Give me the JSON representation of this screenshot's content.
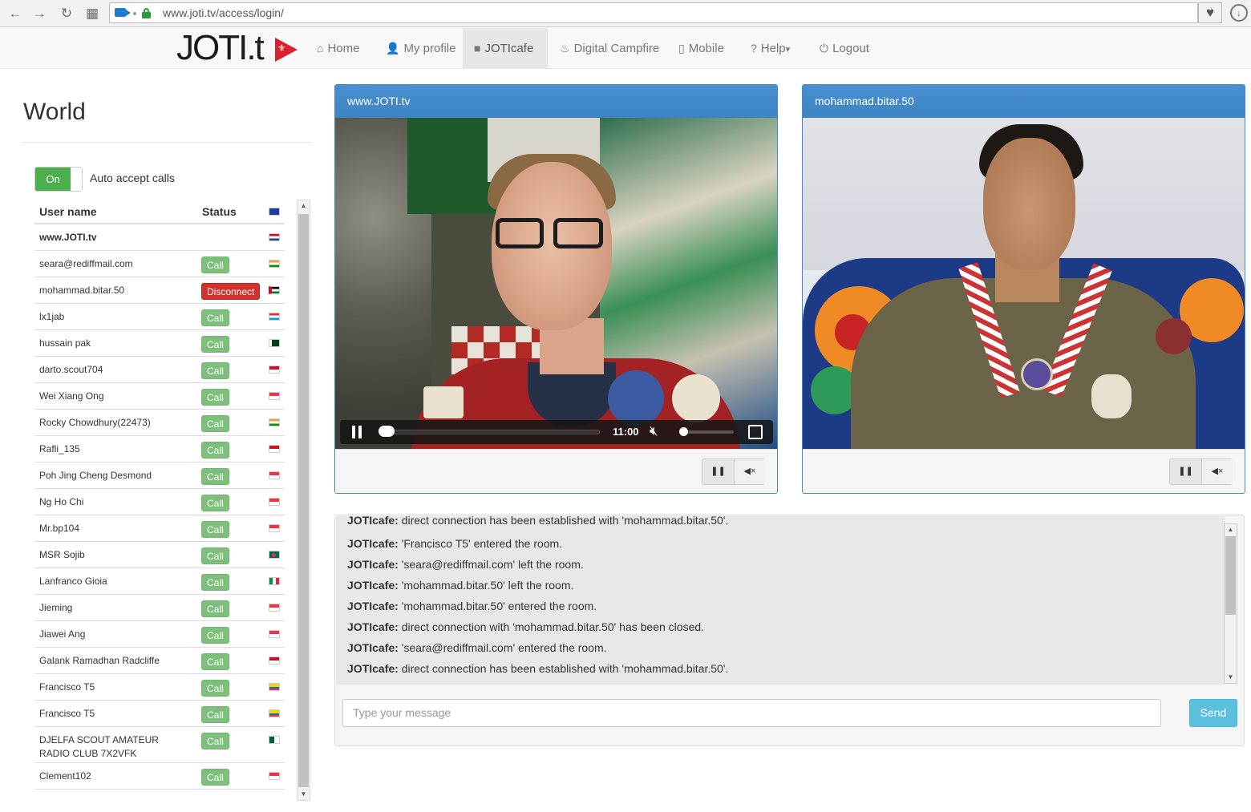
{
  "browser": {
    "url": "www.joti.tv/access/login/",
    "back_icon": "←",
    "forward_icon": "→",
    "reload_icon": "↻",
    "apps_icon": "▦",
    "heart_icon": "♥",
    "download_icon": "↓"
  },
  "navbar": {
    "logo": "JOTI.t",
    "items": [
      {
        "label": "Home",
        "icon": "home-icon",
        "glyph": "⌂"
      },
      {
        "label": "My profile",
        "icon": "user-icon",
        "glyph": "👤"
      },
      {
        "label": "JOTIcafe",
        "icon": "video-camera-icon",
        "glyph": "■"
      },
      {
        "label": "Digital Campfire",
        "icon": "fire-icon",
        "glyph": "♨"
      },
      {
        "label": "Mobile",
        "icon": "mobile-icon",
        "glyph": "▯"
      },
      {
        "label": "Help",
        "icon": "question-icon",
        "glyph": "?",
        "caret": "▾"
      },
      {
        "label": "Logout",
        "icon": "power-icon",
        "glyph": "⏻"
      }
    ],
    "active": "JOTIcafe"
  },
  "sidebar": {
    "title": "World",
    "toggle_label": "On",
    "auto_accept_label": "Auto accept calls",
    "columns": [
      "User name",
      "Status"
    ],
    "header_flag": "eu",
    "users": [
      {
        "name": "www.JOTI.tv",
        "action": "",
        "flag": "nl"
      },
      {
        "name": "seara@rediffmail.com",
        "action": "Call",
        "flag": "in"
      },
      {
        "name": "mohammad.bitar.50",
        "action": "Disconnect",
        "flag": "jo"
      },
      {
        "name": "lx1jab",
        "action": "Call",
        "flag": "lu"
      },
      {
        "name": "hussain pak",
        "action": "Call",
        "flag": "pk"
      },
      {
        "name": "darto.scout704",
        "action": "Call",
        "flag": "id"
      },
      {
        "name": "Wei Xiang Ong",
        "action": "Call",
        "flag": "sg"
      },
      {
        "name": "Rocky Chowdhury(22473)",
        "action": "Call",
        "flag": "in"
      },
      {
        "name": "Rafli_135",
        "action": "Call",
        "flag": "id"
      },
      {
        "name": "Poh Jing Cheng Desmond",
        "action": "Call",
        "flag": "sg"
      },
      {
        "name": "Ng Ho Chi",
        "action": "Call",
        "flag": "sg"
      },
      {
        "name": "Mr.bp104",
        "action": "Call",
        "flag": "sg"
      },
      {
        "name": "MSR Sojib",
        "action": "Call",
        "flag": "bd"
      },
      {
        "name": "Lanfranco Gioia",
        "action": "Call",
        "flag": "it"
      },
      {
        "name": "Jieming",
        "action": "Call",
        "flag": "sg"
      },
      {
        "name": "Jiawei Ang",
        "action": "Call",
        "flag": "sg"
      },
      {
        "name": "Galank Ramadhan Radcliffe",
        "action": "Call",
        "flag": "id"
      },
      {
        "name": "Francisco T5",
        "action": "Call",
        "flag": "ec"
      },
      {
        "name": "Francisco T5",
        "action": "Call",
        "flag": "ec"
      },
      {
        "name": "DJELFA SCOUT AMATEUR RADIO CLUB 7X2VFK",
        "action": "Call",
        "flag": "dz"
      },
      {
        "name": "Clement102",
        "action": "Call",
        "flag": "sg"
      }
    ]
  },
  "videos": [
    {
      "title": "www.JOTI.tv",
      "time": "11:00",
      "progress": 0.0,
      "volume": 0.0
    },
    {
      "title": "mohammad.bitar.50"
    }
  ],
  "chat": {
    "sender": "JOTIcafe:",
    "messages": [
      "direct connection has been established with 'mohammad.bitar.50'.",
      "'Francisco T5' entered the room.",
      "'seara@rediffmail.com' left the room.",
      "'mohammad.bitar.50' left the room.",
      "'mohammad.bitar.50' entered the room.",
      "direct connection with 'mohammad.bitar.50' has been closed.",
      "'seara@rediffmail.com' entered the room.",
      "direct connection has been established with 'mohammad.bitar.50'."
    ],
    "placeholder": "Type your message",
    "send_label": "Send"
  }
}
